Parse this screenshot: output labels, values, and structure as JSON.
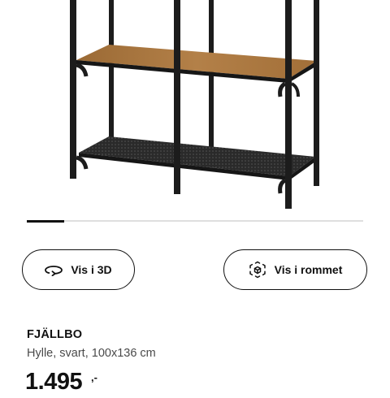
{
  "product": {
    "name": "FJÄLLBO",
    "description": "Hylle, svart, 100x136 cm",
    "price": "1.495",
    "price_suffix": ",-"
  },
  "carousel": {
    "progress": 0.11
  },
  "buttons": {
    "view_3d": {
      "label": "Vis i 3D",
      "icon": "rotate-3d-icon"
    },
    "view_in_room": {
      "label": "Vis i rommet",
      "icon": "ar-cube-icon"
    }
  },
  "colors": {
    "text": "#111111",
    "secondary_text": "#4a4a4a",
    "wood": "#a9773f",
    "frame": "#1c1c1c"
  }
}
